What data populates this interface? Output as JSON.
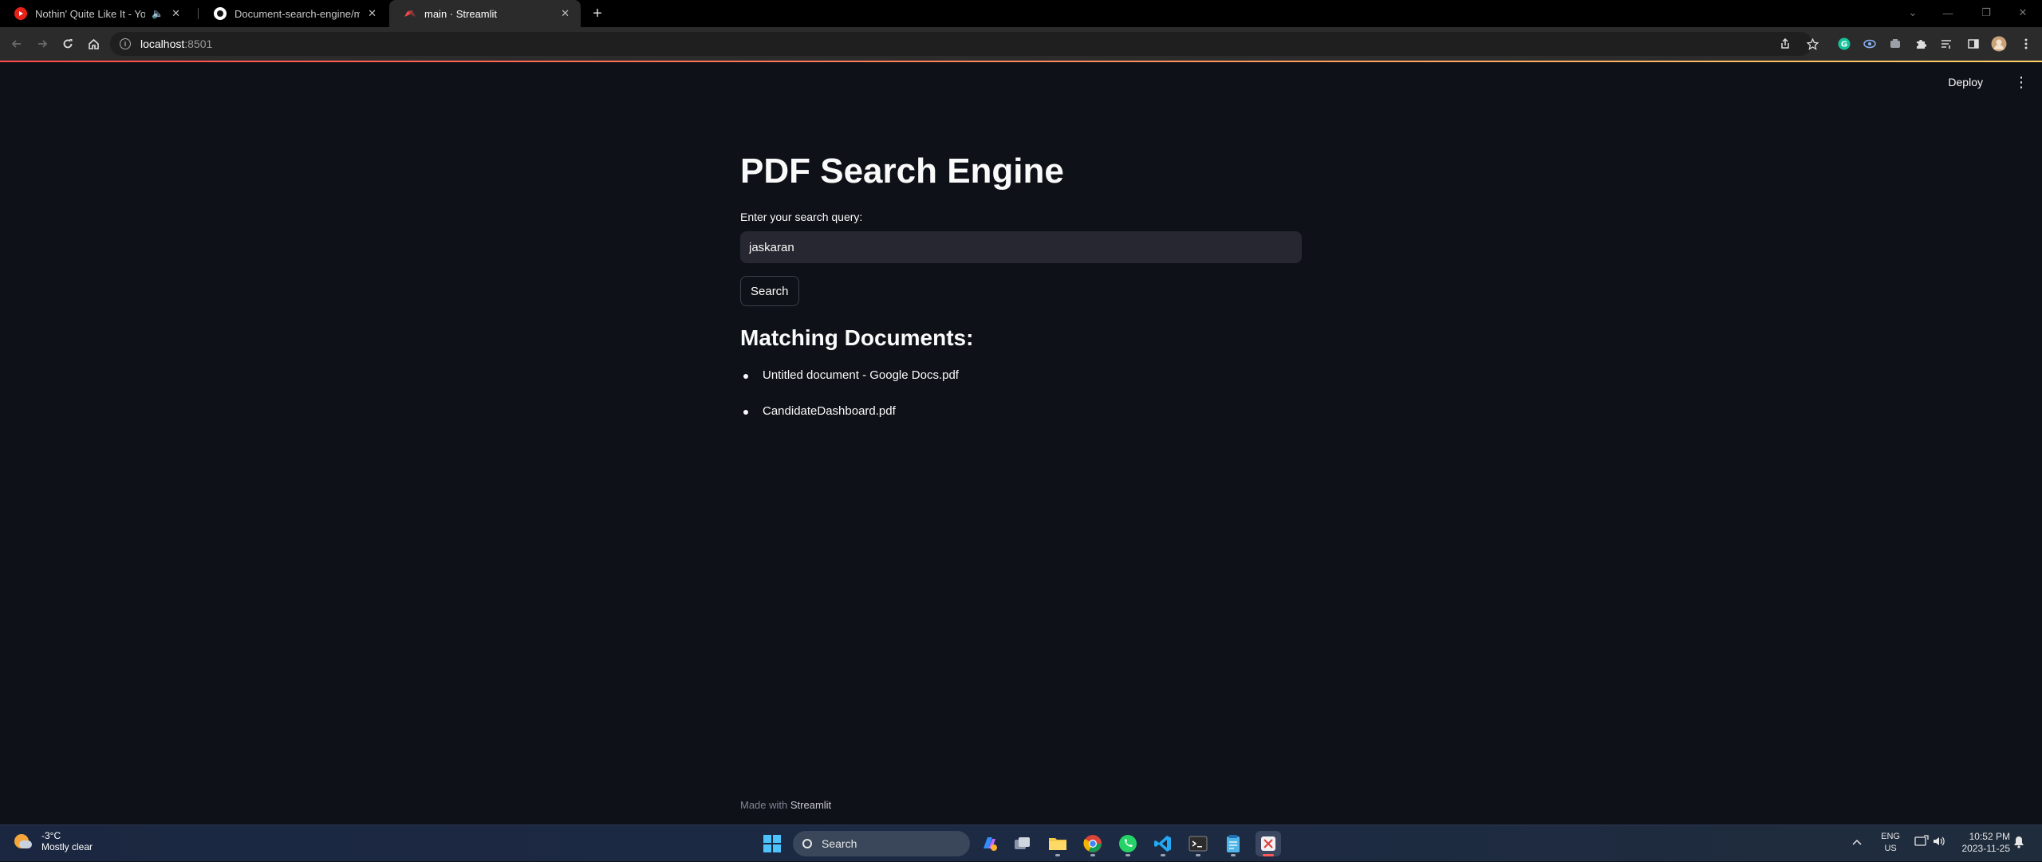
{
  "browser": {
    "tabs": [
      {
        "title": "Nothin' Quite Like It - YouT",
        "aux": "🔈",
        "close": "✕"
      },
      {
        "title": "Document-search-engine/main.",
        "close": "✕"
      },
      {
        "title": "main · Streamlit",
        "close": "✕"
      }
    ],
    "new_tab": "+",
    "window_controls": {
      "minimize": "—",
      "maximize": "❐",
      "close": "✕",
      "tab_search": "⌄"
    },
    "address": {
      "host": "localhost",
      "port": ":8501"
    }
  },
  "app": {
    "deploy_label": "Deploy",
    "menu": "⋮",
    "title": "PDF Search Engine",
    "query_label": "Enter your search query:",
    "query_value": "jaskaran",
    "search_button": "Search",
    "results_heading": "Matching Documents:",
    "results": [
      "Untitled document - Google Docs.pdf",
      "CandidateDashboard.pdf"
    ],
    "footer": {
      "prefix": "Made with ",
      "brand": "Streamlit"
    }
  },
  "taskbar": {
    "weather": {
      "temp": "-3°C",
      "condition": "Mostly clear"
    },
    "search_placeholder": "Search",
    "lang": {
      "line1": "ENG",
      "line2": "US"
    },
    "clock": {
      "time": "10:52 PM",
      "date": "2023-11-25"
    }
  },
  "colors": {
    "app_bg": "#0e1117",
    "input_bg": "#262730",
    "streamlit_accent": "#ff4b4b",
    "taskbar_bg": "#1c2a44"
  }
}
